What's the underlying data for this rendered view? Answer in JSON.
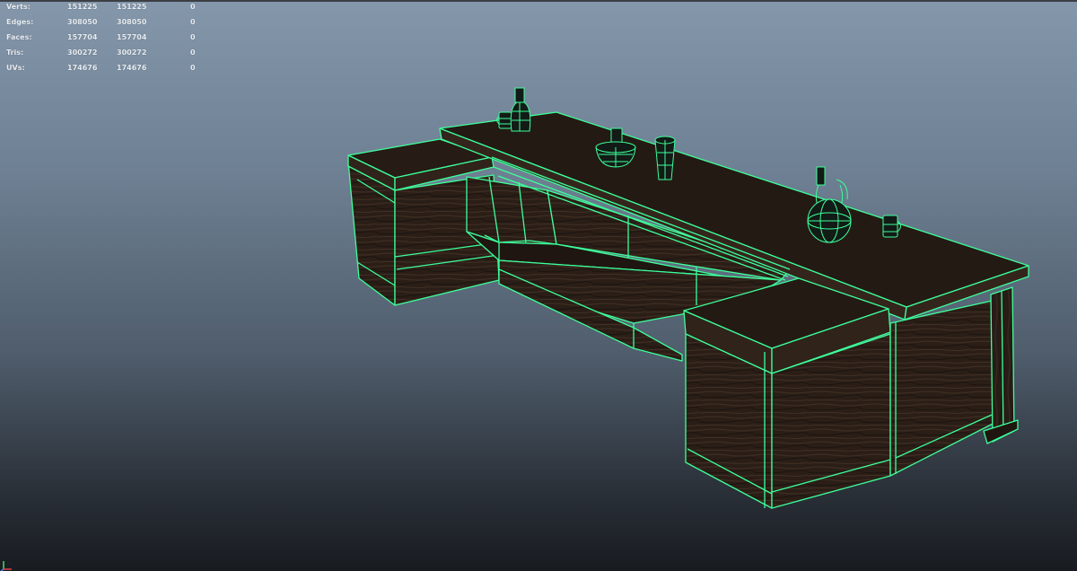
{
  "hud": {
    "rows": [
      {
        "label": "Verts:",
        "a": "151225",
        "b": "151225",
        "c": "0"
      },
      {
        "label": "Edges:",
        "a": "308050",
        "b": "308050",
        "c": "0"
      },
      {
        "label": "Faces:",
        "a": "157704",
        "b": "157704",
        "c": "0"
      },
      {
        "label": "Tris:",
        "a": "300272",
        "b": "300272",
        "c": "0"
      },
      {
        "label": "UVs:",
        "a": "174676",
        "b": "174676",
        "c": "0"
      }
    ]
  },
  "colors": {
    "wireframe": "#3dff9a",
    "wood_dark": "#2a1e17",
    "wood_mid": "#3d2c22",
    "viewport_top": "#8497ab",
    "viewport_bottom": "#181b20"
  },
  "icons": {
    "axis_gizmo": "axis-gizmo-icon",
    "bar_counter": "bar-counter-model",
    "props": [
      "mug-icon",
      "bottle-icon",
      "bowl-icon",
      "glass-icon",
      "jug-icon",
      "mug-icon"
    ]
  }
}
